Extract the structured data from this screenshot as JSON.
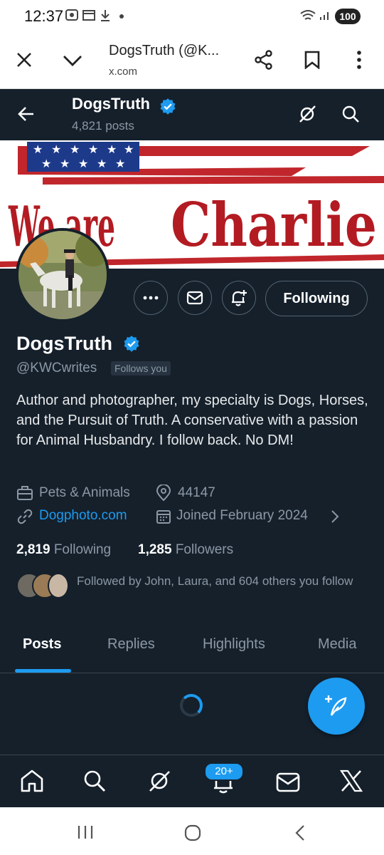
{
  "status_bar": {
    "time": "12:37",
    "battery": "100"
  },
  "browser": {
    "title": "DogsTruth (@K...",
    "url": "x.com"
  },
  "header": {
    "name": "DogsTruth",
    "posts_count": "4,821 posts"
  },
  "banner": {
    "line1": "We are",
    "line2": "Charlie"
  },
  "profile": {
    "name": "DogsTruth",
    "handle": "@KWCwrites",
    "follows_you": "Follows you",
    "following_button": "Following",
    "bio": "Author and photographer, my specialty is Dogs, Horses, and the Pursuit of Truth. A conservative with a passion for Animal Husbandry. I follow back. No DM!",
    "category": "Pets & Animals",
    "location": "44147",
    "website": "Dogphoto.com",
    "joined": "Joined February 2024",
    "following_count": "2,819",
    "following_label": "Following",
    "followers_count": "1,285",
    "followers_label": "Followers",
    "followed_by": "Followed by John, Laura, and 604 others you follow"
  },
  "tabs": [
    {
      "label": "Posts",
      "active": true
    },
    {
      "label": "Replies"
    },
    {
      "label": "Highlights"
    },
    {
      "label": "Media"
    }
  ],
  "bottom_nav": {
    "notifications_badge": "20+"
  },
  "colors": {
    "background": "#15202b",
    "accent": "#1d9bf0",
    "text": "#e7e9ea",
    "muted": "#8b98a5"
  }
}
